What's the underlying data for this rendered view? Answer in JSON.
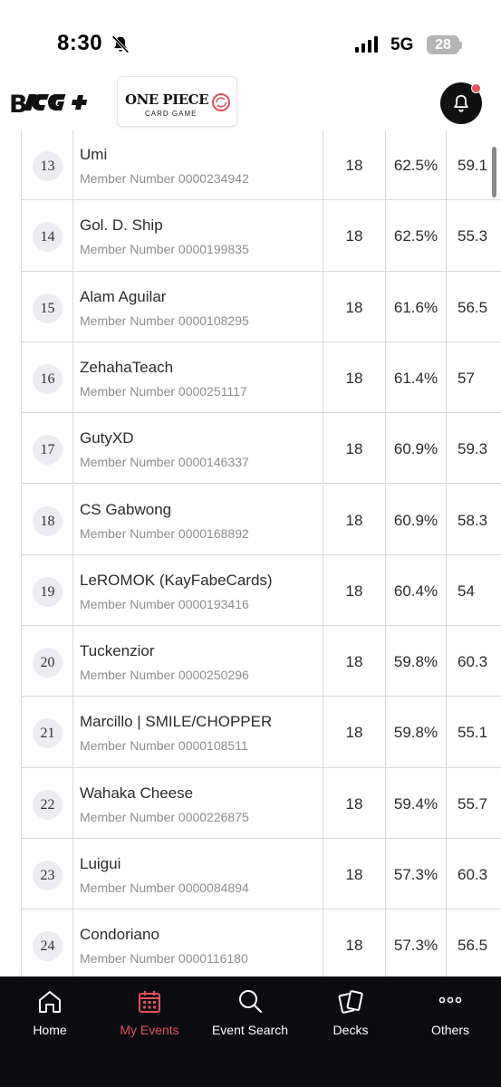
{
  "status_bar": {
    "time": "8:30",
    "network": "5G",
    "battery": "28"
  },
  "header": {
    "brand_logo": "B",
    "game_logo_title": "ONE PIECE",
    "game_logo_subtitle": "CARD GAME"
  },
  "colors": {
    "accent": "#e3505c",
    "nav_bg": "#0c0c10",
    "rank_badge_bg": "#ececf2",
    "grid_line": "#d8d8dc"
  },
  "rankings": [
    {
      "rank": "13",
      "name": "Umi",
      "member": "Member Number 0000234942",
      "points": "18",
      "omw": "62.5%",
      "gw": "59.1"
    },
    {
      "rank": "14",
      "name": "Gol. D. Ship",
      "member": "Member Number 0000199835",
      "points": "18",
      "omw": "62.5%",
      "gw": "55.3"
    },
    {
      "rank": "15",
      "name": "Alam Aguilar",
      "member": "Member Number 0000108295",
      "points": "18",
      "omw": "61.6%",
      "gw": "56.5"
    },
    {
      "rank": "16",
      "name": "ZehahaTeach",
      "member": "Member Number 0000251117",
      "points": "18",
      "omw": "61.4%",
      "gw": "57"
    },
    {
      "rank": "17",
      "name": "GutyXD",
      "member": "Member Number 0000146337",
      "points": "18",
      "omw": "60.9%",
      "gw": "59.3"
    },
    {
      "rank": "18",
      "name": "CS Gabwong",
      "member": "Member Number 0000168892",
      "points": "18",
      "omw": "60.9%",
      "gw": "58.3"
    },
    {
      "rank": "19",
      "name": "LeROMOK (KayFabeCards)",
      "member": "Member Number 0000193416",
      "points": "18",
      "omw": "60.4%",
      "gw": "54"
    },
    {
      "rank": "20",
      "name": "Tuckenzior",
      "member": "Member Number 0000250296",
      "points": "18",
      "omw": "59.8%",
      "gw": "60.3"
    },
    {
      "rank": "21",
      "name": "Marcillo | SMILE/CHOPPER",
      "member": "Member Number 0000108511",
      "points": "18",
      "omw": "59.8%",
      "gw": "55.1"
    },
    {
      "rank": "22",
      "name": "Wahaka Cheese",
      "member": "Member Number 0000226875",
      "points": "18",
      "omw": "59.4%",
      "gw": "55.7"
    },
    {
      "rank": "23",
      "name": "Luigui",
      "member": "Member Number 0000084894",
      "points": "18",
      "omw": "57.3%",
      "gw": "60.3"
    },
    {
      "rank": "24",
      "name": "Condoriano",
      "member": "Member Number 0000116180",
      "points": "18",
      "omw": "57.3%",
      "gw": "56.5"
    }
  ],
  "bottom_nav": [
    {
      "label": "Home",
      "icon": "home-icon",
      "active": false
    },
    {
      "label": "My Events",
      "icon": "calendar-icon",
      "active": true
    },
    {
      "label": "Event Search",
      "icon": "search-icon",
      "active": false
    },
    {
      "label": "Decks",
      "icon": "cards-icon",
      "active": false
    },
    {
      "label": "Others",
      "icon": "more-icon",
      "active": false
    }
  ]
}
